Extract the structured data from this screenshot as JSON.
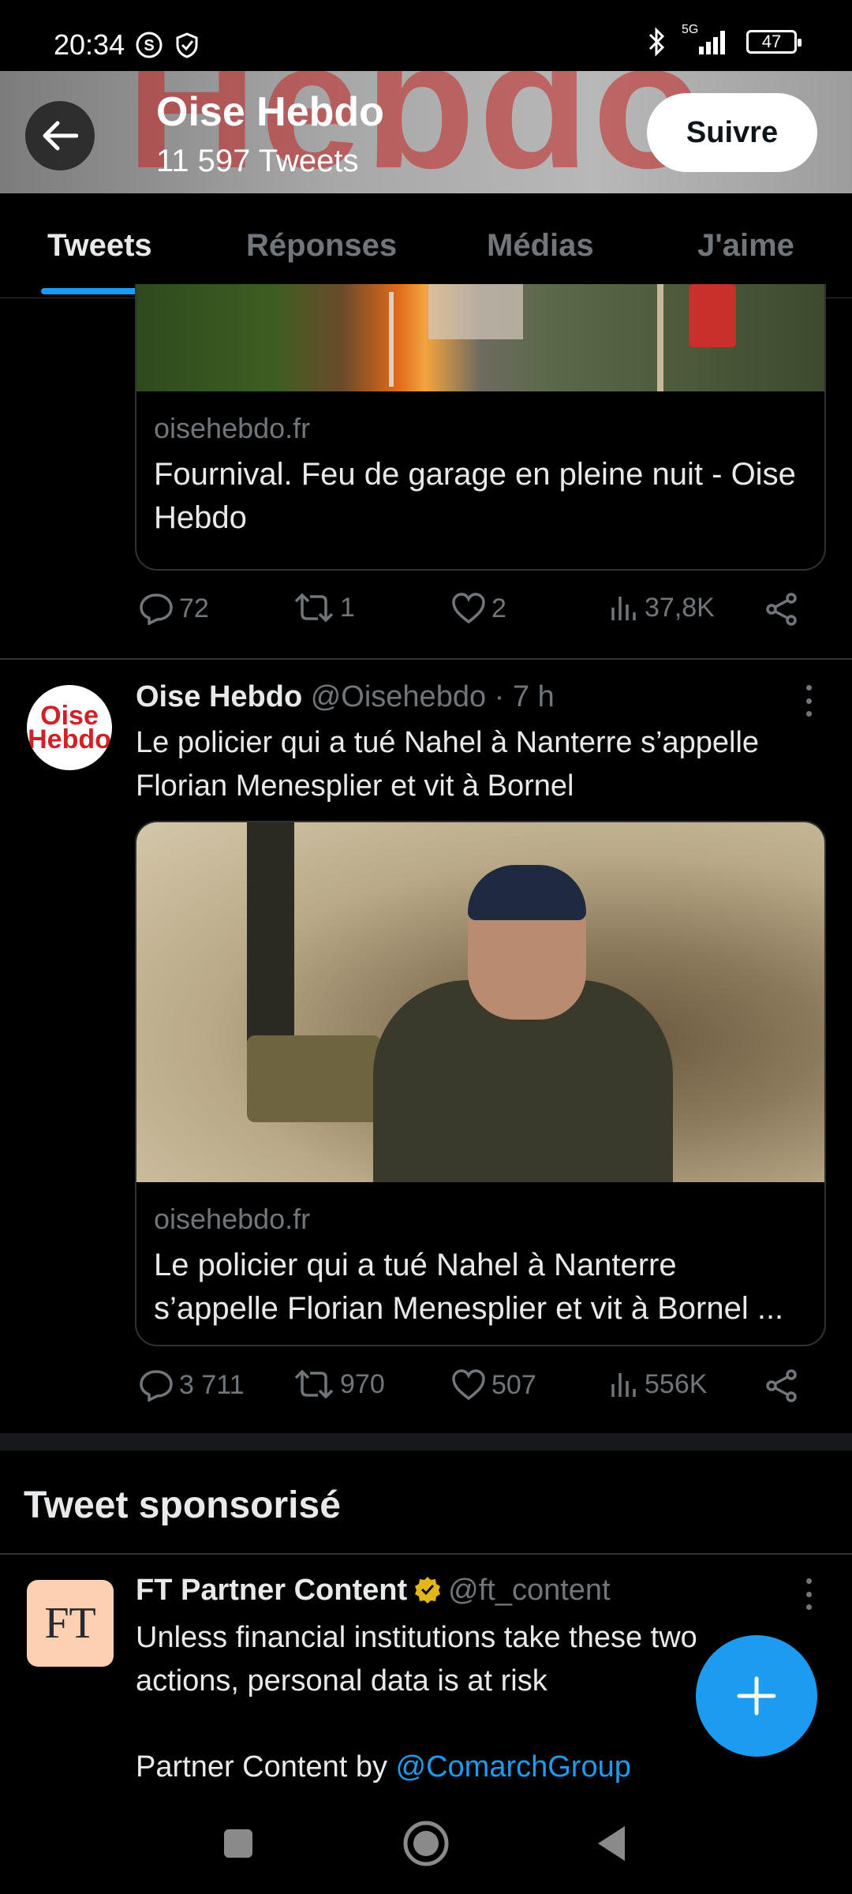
{
  "status_bar": {
    "time": "20:34",
    "network": "5G",
    "battery": "47"
  },
  "header": {
    "title": "Oise Hebdo",
    "subtitle": "11 597 Tweets",
    "follow_label": "Suivre",
    "banner_text": "Hebdo"
  },
  "tabs": [
    {
      "label": "Tweets",
      "active": true
    },
    {
      "label": "Réponses",
      "active": false
    },
    {
      "label": "Médias",
      "active": false
    },
    {
      "label": "J'aime",
      "active": false
    }
  ],
  "tweets": [
    {
      "card": {
        "domain": "oisehebdo.fr",
        "title": "Fournival. Feu de garage en pleine nuit - Oise Hebdo"
      },
      "stats": {
        "replies": "72",
        "retweets": "1",
        "likes": "2",
        "views": "37,8K"
      }
    },
    {
      "avatar_text": [
        "Oise",
        "Hebdo"
      ],
      "author": "Oise Hebdo",
      "handle": "@Oisehebdo",
      "time": "· 7 h",
      "text": "Le policier qui a tué Nahel à Nanterre s’appelle Florian Menesplier et vit à Bornel",
      "card": {
        "domain": "oisehebdo.fr",
        "title": "Le policier qui a tué Nahel à Nanterre s’appelle Florian Menesplier et vit à Bornel ..."
      },
      "stats": {
        "replies": "3 711",
        "retweets": "970",
        "likes": "507",
        "views": "556K"
      }
    }
  ],
  "sponsored": {
    "section_title": "Tweet sponsorisé",
    "avatar_text": "FT",
    "author": "FT Partner Content",
    "handle": "@ft_content",
    "text": "Unless financial institutions take these two actions, personal data is at risk",
    "partner_prefix": "Partner Content by ",
    "partner_link": "@ComarchGroup"
  },
  "colors": {
    "accent": "#1d9bf0",
    "background": "#000000",
    "muted": "#71767b",
    "brand_red": "#d32027"
  }
}
